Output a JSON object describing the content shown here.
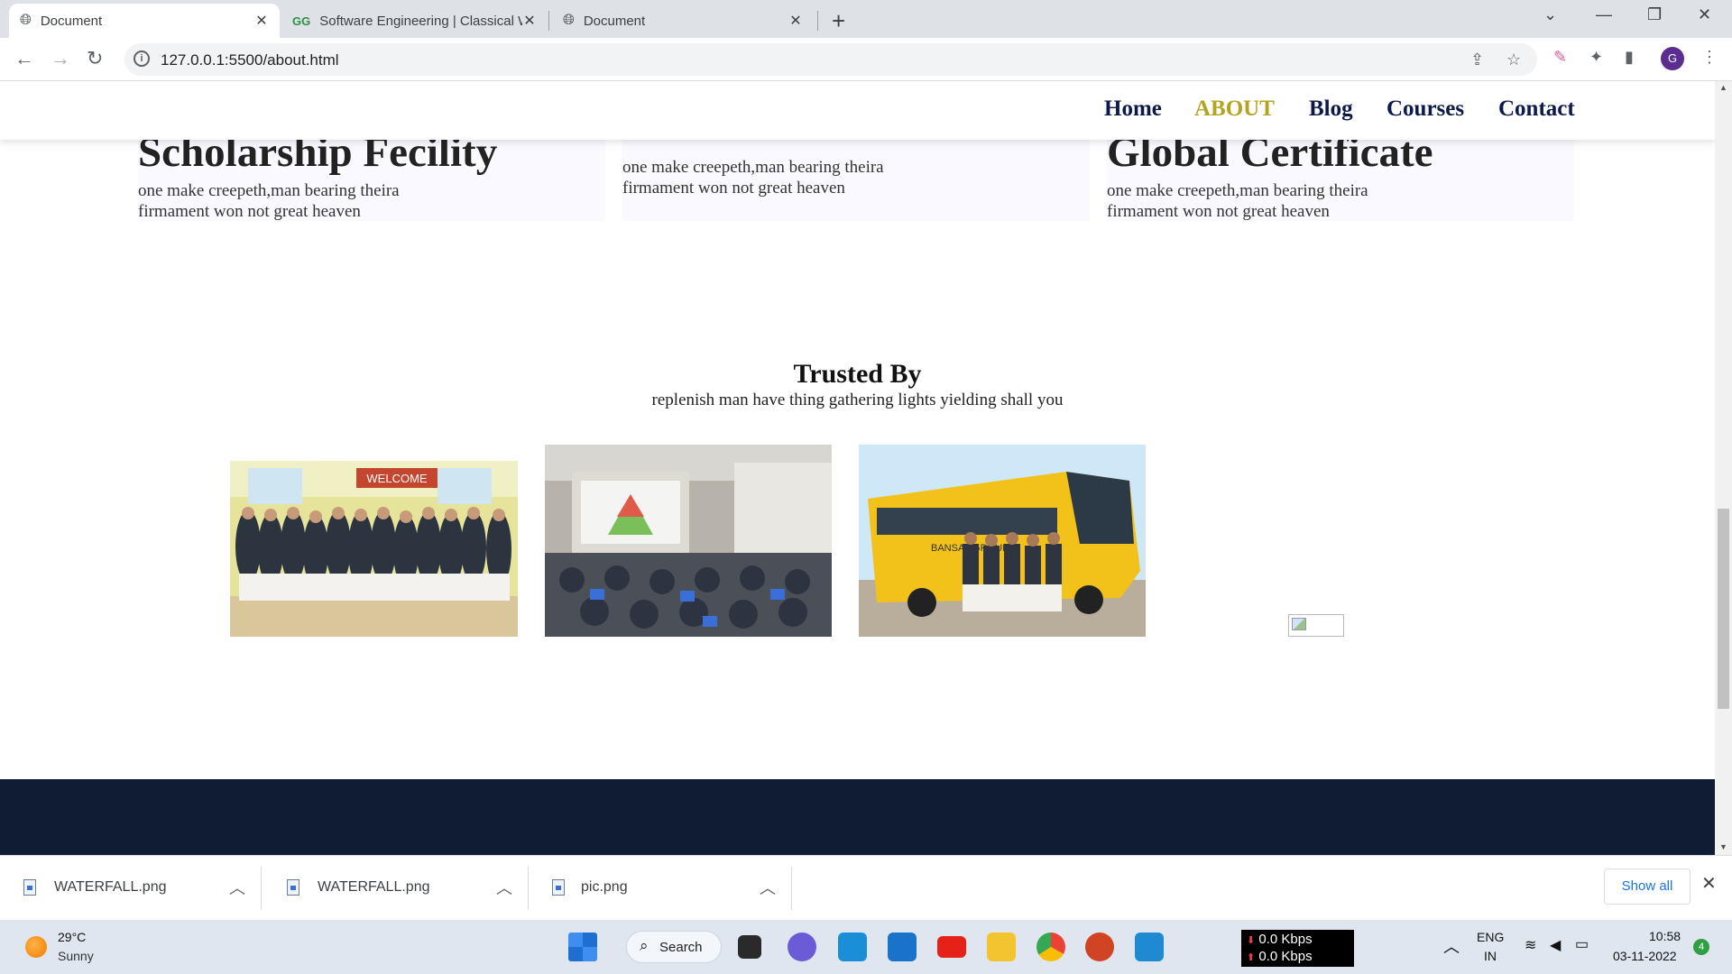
{
  "browser": {
    "tabs": [
      {
        "title": "Document",
        "active": true
      },
      {
        "title": "Software Engineering | Classical Wa",
        "active": false
      },
      {
        "title": "Document",
        "active": false
      }
    ],
    "url": "127.0.0.1:5500/about.html"
  },
  "page": {
    "nav": {
      "items": [
        {
          "label": "Home",
          "active": false
        },
        {
          "label": "ABOUT",
          "active": true
        },
        {
          "label": "Blog",
          "active": false
        },
        {
          "label": "Courses",
          "active": false
        },
        {
          "label": "Contact",
          "active": false
        }
      ]
    },
    "features": [
      {
        "title": "Scholarship Fecility",
        "text": "one make creepeth,man bearing theira firmament won not great heaven"
      },
      {
        "title": "",
        "text": "one make creepeth,man bearing theira firmament won not great heaven"
      },
      {
        "title": "Global Certificate",
        "text": "one make creepeth,man bearing theira firmament won not great heaven"
      }
    ],
    "trusted": {
      "title": "Trusted By",
      "subtitle": "replenish man have thing gathering lights yielding shall you",
      "welcome_banner": "WELCOME",
      "bus_label": "BANSAL GROUP"
    }
  },
  "downloads": {
    "items": [
      {
        "name": "WATERFALL.png"
      },
      {
        "name": "WATERFALL.png"
      },
      {
        "name": "pic.png"
      }
    ],
    "show_all": "Show all"
  },
  "taskbar": {
    "weather": {
      "temp": "29°C",
      "condition": "Sunny"
    },
    "search_label": "Search",
    "net": {
      "down": "0.0 Kbps",
      "up": "0.0 Kbps"
    },
    "lang": {
      "line1": "ENG",
      "line2": "IN"
    },
    "clock": {
      "time": "10:58",
      "date": "03-11-2022"
    },
    "notifications": "4"
  },
  "colors": {
    "nav_text": "#0c1a4b",
    "nav_active": "#b3a41f",
    "footer": "#0f1c34",
    "feature_bg": "#f9f9ff"
  }
}
